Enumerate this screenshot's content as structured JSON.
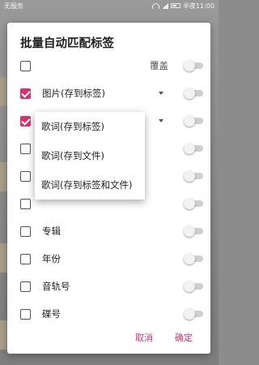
{
  "status_bar": {
    "carrier": "无服务",
    "time": "半夜11:00"
  },
  "dialog": {
    "title": "批量自动匹配标签",
    "rows": [
      {
        "label": "",
        "right_label": "覆盖",
        "checked": false,
        "has_dropdown": false,
        "toggle_on": false
      },
      {
        "label": "图片(存到标签)",
        "checked": true,
        "has_dropdown": true,
        "toggle_on": false
      },
      {
        "label": "",
        "checked": true,
        "has_dropdown": true,
        "toggle_on": false
      },
      {
        "label": "",
        "checked": false,
        "has_dropdown": false,
        "toggle_on": false
      },
      {
        "label": "",
        "checked": false,
        "has_dropdown": false,
        "toggle_on": false
      },
      {
        "label": "",
        "checked": false,
        "has_dropdown": false,
        "toggle_on": false
      },
      {
        "label": "专辑",
        "checked": false,
        "has_dropdown": false,
        "toggle_on": false
      },
      {
        "label": "年份",
        "checked": false,
        "has_dropdown": false,
        "toggle_on": false
      },
      {
        "label": "音轨号",
        "checked": false,
        "has_dropdown": false,
        "toggle_on": false
      },
      {
        "label": "碟号",
        "checked": false,
        "has_dropdown": false,
        "toggle_on": false
      }
    ],
    "cancel_label": "取消",
    "confirm_label": "确定"
  },
  "popup_menu": {
    "items": [
      "歌词(存到标签)",
      "歌词(存到文件)",
      "歌词(存到标签和文件)"
    ]
  },
  "colors": {
    "accent": "#d6336c",
    "toggle_track": "#cfcfcf"
  }
}
